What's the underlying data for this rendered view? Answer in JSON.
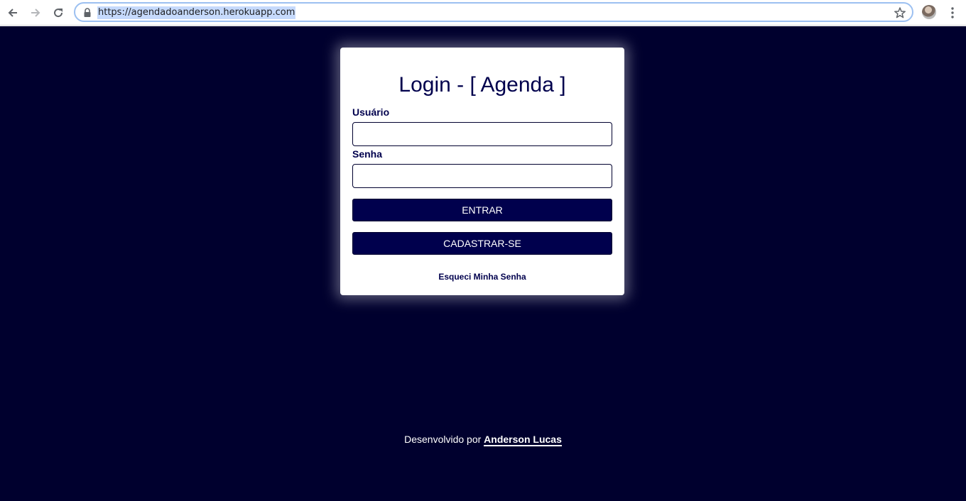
{
  "browser": {
    "url": "https://agendadoanderson.herokuapp.com",
    "icons": {
      "back": "back-arrow-icon",
      "forward": "forward-arrow-icon",
      "reload": "reload-icon",
      "lock": "lock-icon",
      "bookmark": "star-icon",
      "menu": "kebab-menu-icon"
    }
  },
  "login": {
    "title": "Login - [ Agenda ]",
    "username_label": "Usuário",
    "username_value": "",
    "password_label": "Senha",
    "password_value": "",
    "submit_label": "ENTRAR",
    "register_label": "CADASTRAR-SE",
    "forgot_label": "Esqueci Minha Senha"
  },
  "footer": {
    "prefix": "Desenvolvido por",
    "author": "Anderson Lucas"
  },
  "colors": {
    "page_background": "#00002e",
    "brand": "#00004d",
    "card": "#ffffff"
  }
}
